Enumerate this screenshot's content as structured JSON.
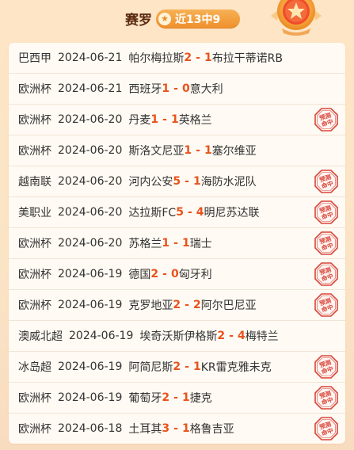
{
  "header": {
    "title": "赛罗",
    "record": "近13中9"
  },
  "stamp_text": [
    "预测",
    "命中"
  ],
  "matches": [
    {
      "league": "巴西甲",
      "date": "2024-06-21",
      "home": "帕尔梅拉斯",
      "home_score": "2",
      "away_score": "1",
      "away": "布拉干蒂诺RB",
      "hit": false
    },
    {
      "league": "欧洲杯",
      "date": "2024-06-21",
      "home": "西班牙",
      "home_score": "1",
      "away_score": "0",
      "away": "意大利",
      "hit": false
    },
    {
      "league": "欧洲杯",
      "date": "2024-06-20",
      "home": "丹麦",
      "home_score": "1",
      "away_score": "1",
      "away": "英格兰",
      "hit": true
    },
    {
      "league": "欧洲杯",
      "date": "2024-06-20",
      "home": "斯洛文尼亚",
      "home_score": "1",
      "away_score": "1",
      "away": "塞尔维亚",
      "hit": false
    },
    {
      "league": "越南联",
      "date": "2024-06-20",
      "home": "河内公安",
      "home_score": "5",
      "away_score": "1",
      "away": "海防水泥队",
      "hit": true
    },
    {
      "league": "美职业",
      "date": "2024-06-20",
      "home": "达拉斯FC",
      "home_score": "5",
      "away_score": "4",
      "away": "明尼苏达联",
      "hit": true
    },
    {
      "league": "欧洲杯",
      "date": "2024-06-20",
      "home": "苏格兰",
      "home_score": "1",
      "away_score": "1",
      "away": "瑞士",
      "hit": true
    },
    {
      "league": "欧洲杯",
      "date": "2024-06-19",
      "home": "德国",
      "home_score": "2",
      "away_score": "0",
      "away": "匈牙利",
      "hit": true
    },
    {
      "league": "欧洲杯",
      "date": "2024-06-19",
      "home": "克罗地亚",
      "home_score": "2",
      "away_score": "2",
      "away": "阿尔巴尼亚",
      "hit": true
    },
    {
      "league": "澳威北超",
      "date": "2024-06-19",
      "home": "埃奇沃斯伊格斯",
      "home_score": "2",
      "away_score": "4",
      "away": "梅特兰",
      "hit": false
    },
    {
      "league": "冰岛超",
      "date": "2024-06-19",
      "home": "阿简尼斯",
      "home_score": "2",
      "away_score": "1",
      "away": "KR雷克雅未克",
      "hit": true
    },
    {
      "league": "欧洲杯",
      "date": "2024-06-19",
      "home": "葡萄牙",
      "home_score": "2",
      "away_score": "1",
      "away": "捷克",
      "hit": true
    },
    {
      "league": "欧洲杯",
      "date": "2024-06-18",
      "home": "土耳其",
      "home_score": "3",
      "away_score": "1",
      "away": "格鲁吉亚",
      "hit": true
    }
  ],
  "colors": {
    "accent": "#e8531c",
    "stamp": "#d9463a",
    "badge": "#ef8f2c"
  },
  "icons": {
    "record_badge": "star-icon",
    "decor": "medal-icon",
    "hit": "prediction-hit-stamp-icon"
  }
}
